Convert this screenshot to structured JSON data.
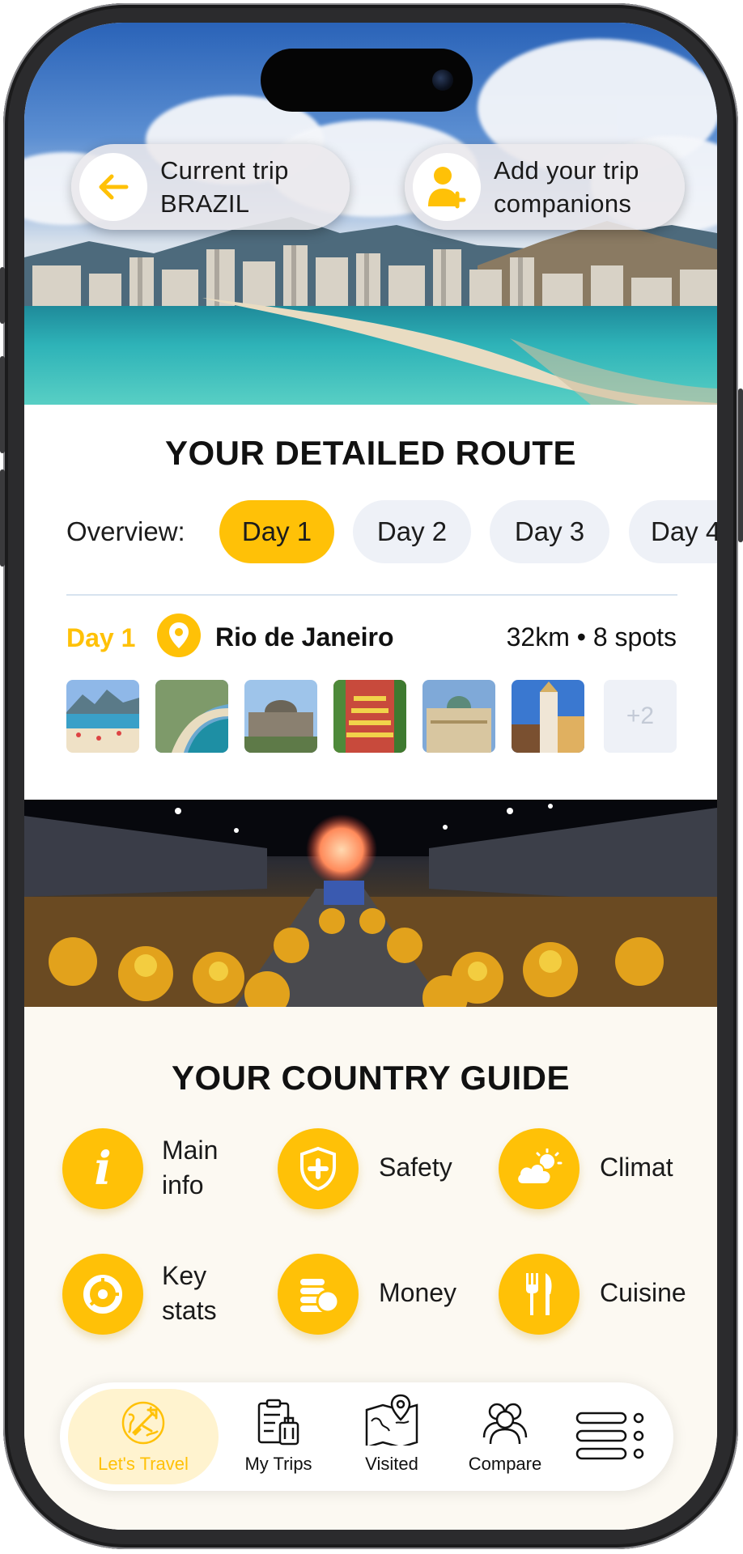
{
  "hero": {
    "back_pill": {
      "line1": "Current trip",
      "line2": "BRAZIL"
    },
    "companions_pill": {
      "line1": "Add your trip",
      "line2": "companions"
    }
  },
  "route": {
    "title": "YOUR DETAILED ROUTE",
    "overview_label": "Overview:",
    "days": [
      "Day 1",
      "Day 2",
      "Day 3",
      "Day 4"
    ],
    "active_day": "Day 1",
    "selected": {
      "day": "Day 1",
      "city": "Rio de Janeiro",
      "stats": "32km • 8 spots"
    },
    "more_count": "+2"
  },
  "guide": {
    "title": "YOUR COUNTRY GUIDE",
    "items": [
      {
        "line1": "Main",
        "line2": "info",
        "icon": "info-icon"
      },
      {
        "line1": "Safety",
        "line2": "",
        "icon": "shield-icon"
      },
      {
        "line1": "Climat",
        "line2": "",
        "icon": "weather-icon"
      },
      {
        "line1": "Key",
        "line2": "stats",
        "icon": "pie-chart-icon"
      },
      {
        "line1": "Money",
        "line2": "",
        "icon": "coins-icon"
      },
      {
        "line1": "Cuisine",
        "line2": "",
        "icon": "cutlery-icon"
      }
    ]
  },
  "nav": {
    "items": [
      {
        "label": "Let's Travel",
        "icon": "globe-plane-icon",
        "active": true
      },
      {
        "label": "My Trips",
        "icon": "clipboard-luggage-icon"
      },
      {
        "label": "Visited",
        "icon": "map-pin-icon"
      },
      {
        "label": "Compare",
        "icon": "people-icon"
      },
      {
        "label": "",
        "icon": "menu-icon"
      }
    ]
  },
  "colors": {
    "accent": "#ffc107",
    "chip_bg": "#eef1f7",
    "guide_bg": "#fcf9f2",
    "nav_active_bg": "#fff3cf"
  }
}
